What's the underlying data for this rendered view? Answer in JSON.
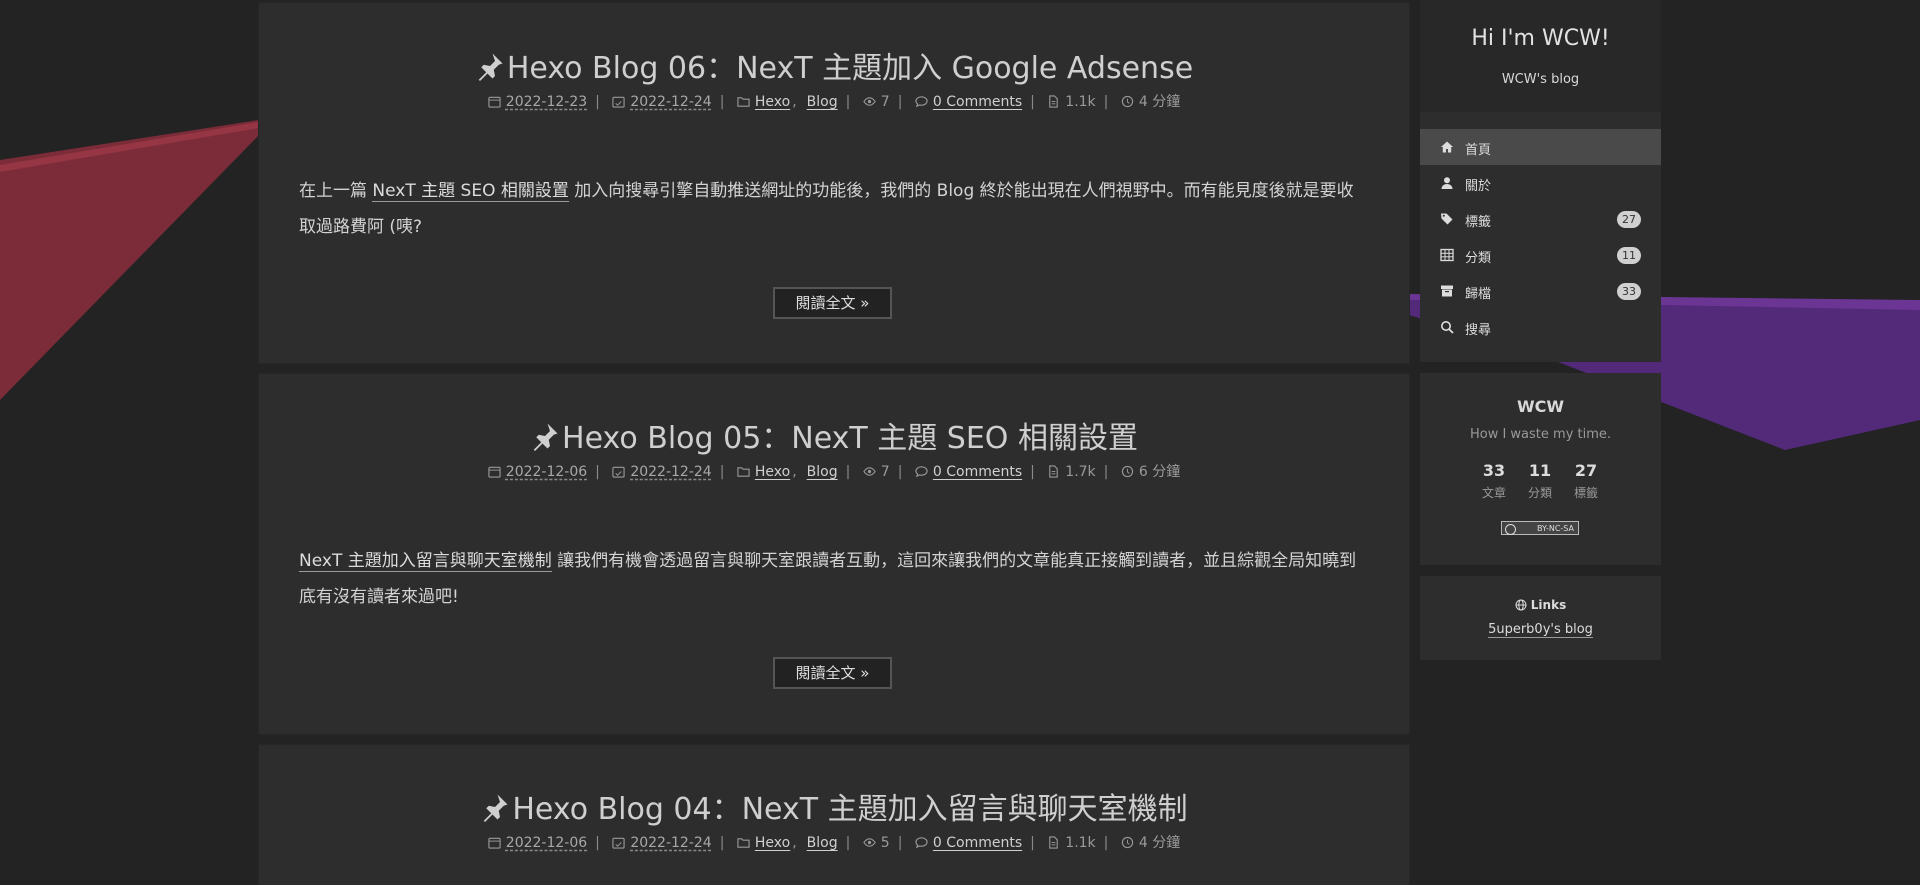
{
  "posts": [
    {
      "title": "Hexo Blog 06：NexT 主題加入 Google Adsense",
      "published": "2022-12-23",
      "updated": "2022-12-24",
      "categories": [
        "Hexo",
        "Blog"
      ],
      "views": "7",
      "comments": "0 Comments",
      "words": "1.1k",
      "read_time": "4 分鐘",
      "excerpt_link": "NexT 主題 SEO 相關設置",
      "excerpt_before": "在上一篇 ",
      "excerpt_after": " 加入向搜尋引擎自動推送網址的功能後，我們的 Blog 終於能出現在人們視野中。而有能見度後就是要收取過路費阿 (咦?",
      "read_more": "閱讀全文 »"
    },
    {
      "title": "Hexo Blog 05：NexT 主題 SEO 相關設置",
      "published": "2022-12-06",
      "updated": "2022-12-24",
      "categories": [
        "Hexo",
        "Blog"
      ],
      "views": "7",
      "comments": "0 Comments",
      "words": "1.7k",
      "read_time": "6 分鐘",
      "excerpt_link": "NexT 主題加入留言與聊天室機制",
      "excerpt_before": "",
      "excerpt_after": " 讓我們有機會透過留言與聊天室跟讀者互動，這回來讓我們的文章能真正接觸到讀者，並且綜觀全局知曉到底有沒有讀者來過吧!",
      "read_more": "閱讀全文 »"
    },
    {
      "title": "Hexo Blog 04：NexT 主題加入留言與聊天室機制",
      "published": "2022-12-06",
      "updated": "2022-12-24",
      "categories": [
        "Hexo",
        "Blog"
      ],
      "views": "5",
      "comments": "0 Comments",
      "words": "1.1k",
      "read_time": "4 分鐘"
    }
  ],
  "sidebar": {
    "brand_title": "Hi I'm WCW!",
    "brand_subtitle": "WCW's blog",
    "menu": [
      {
        "label": "首頁",
        "icon": "home-icon",
        "active": true
      },
      {
        "label": "關於",
        "icon": "user-icon"
      },
      {
        "label": "標籤",
        "icon": "tags-icon",
        "count": "27"
      },
      {
        "label": "分類",
        "icon": "grid-icon",
        "count": "11"
      },
      {
        "label": "歸檔",
        "icon": "archive-icon",
        "count": "33"
      },
      {
        "label": "搜尋",
        "icon": "search-icon"
      }
    ],
    "author": {
      "name": "WCW",
      "description": "How I waste my time.",
      "stats": [
        {
          "value": "33",
          "label": "文章"
        },
        {
          "value": "11",
          "label": "分類"
        },
        {
          "value": "27",
          "label": "標籤"
        }
      ],
      "license_badge": "BY-NC-SA"
    },
    "links": {
      "title": "Links",
      "items": [
        "5uperb0y's blog"
      ]
    }
  },
  "colors": {
    "background": "#232323",
    "card": "#2d2d2d",
    "accent_red": "#8a2e3e",
    "accent_purple": "#5a2d82"
  }
}
